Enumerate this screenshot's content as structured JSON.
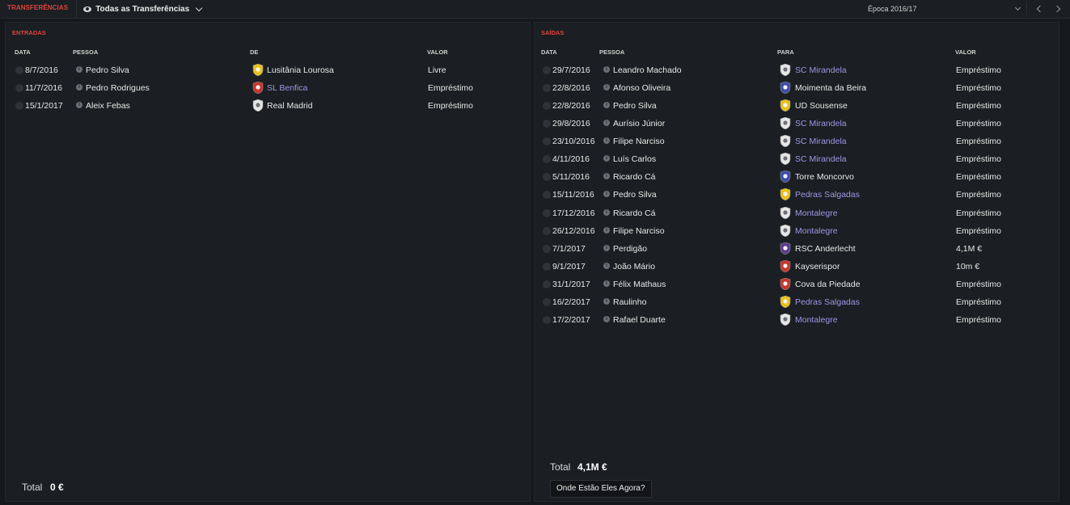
{
  "header": {
    "title": "TRANSFERÊNCIAS",
    "view_label": "Todas as Transferências",
    "season": "Época 2016/17"
  },
  "incoming": {
    "title": "ENTRADAS",
    "columns": {
      "date": "DATA",
      "person": "PESSOA",
      "club": "DE",
      "value": "VALOR"
    },
    "rows": [
      {
        "date": "8/7/2016",
        "person": "Pedro Silva",
        "club": "Lusitânia Lourosa",
        "club_link": false,
        "crest": "crest-yellow",
        "value": "Livre"
      },
      {
        "date": "11/7/2016",
        "person": "Pedro Rodrigues",
        "club": "SL Benfica",
        "club_link": true,
        "crest": "crest-red",
        "value": "Empréstimo"
      },
      {
        "date": "15/1/2017",
        "person": "Aleix Febas",
        "club": "Real Madrid",
        "club_link": false,
        "crest": "crest-white",
        "value": "Empréstimo"
      }
    ],
    "total_label": "Total",
    "total_value": "0 €"
  },
  "outgoing": {
    "title": "SAÍDAS",
    "columns": {
      "date": "DATA",
      "person": "PESSOA",
      "club": "PARA",
      "value": "VALOR"
    },
    "rows": [
      {
        "date": "29/7/2016",
        "person": "Leandro Machado",
        "club": "SC Mirandela",
        "club_link": true,
        "crest": "crest-white",
        "value": "Empréstimo"
      },
      {
        "date": "22/8/2016",
        "person": "Afonso Oliveira",
        "club": "Moimenta da Beira",
        "club_link": false,
        "crest": "crest-blue",
        "value": "Empréstimo"
      },
      {
        "date": "22/8/2016",
        "person": "Pedro Silva",
        "club": "UD Sousense",
        "club_link": false,
        "crest": "crest-yellow",
        "value": "Empréstimo"
      },
      {
        "date": "29/8/2016",
        "person": "Aurísio Júnior",
        "club": "SC Mirandela",
        "club_link": true,
        "crest": "crest-white",
        "value": "Empréstimo"
      },
      {
        "date": "23/10/2016",
        "person": "Filipe Narciso",
        "club": "SC Mirandela",
        "club_link": true,
        "crest": "crest-white",
        "value": "Empréstimo"
      },
      {
        "date": "4/11/2016",
        "person": "Luís Carlos",
        "club": "SC Mirandela",
        "club_link": true,
        "crest": "crest-white",
        "value": "Empréstimo"
      },
      {
        "date": "5/11/2016",
        "person": "Ricardo Cá",
        "club": "Torre Moncorvo",
        "club_link": false,
        "crest": "crest-blue",
        "value": "Empréstimo"
      },
      {
        "date": "15/11/2016",
        "person": "Pedro Silva",
        "club": "Pedras Salgadas",
        "club_link": true,
        "crest": "crest-yellow",
        "value": "Empréstimo"
      },
      {
        "date": "17/12/2016",
        "person": "Ricardo Cá",
        "club": "Montalegre",
        "club_link": true,
        "crest": "crest-white",
        "value": "Empréstimo"
      },
      {
        "date": "26/12/2016",
        "person": "Filipe Narciso",
        "club": "Montalegre",
        "club_link": true,
        "crest": "crest-white",
        "value": "Empréstimo"
      },
      {
        "date": "7/1/2017",
        "person": "Perdigão",
        "club": "RSC Anderlecht",
        "club_link": false,
        "crest": "crest-purple",
        "value": "4,1M €"
      },
      {
        "date": "9/1/2017",
        "person": "João Mário",
        "club": "Kayserispor",
        "club_link": false,
        "crest": "crest-red",
        "value": "10m €"
      },
      {
        "date": "31/1/2017",
        "person": "Félix Mathaus",
        "club": "Cova da Piedade",
        "club_link": false,
        "crest": "crest-red",
        "value": "Empréstimo"
      },
      {
        "date": "16/2/2017",
        "person": "Raulinho",
        "club": "Pedras Salgadas",
        "club_link": true,
        "crest": "crest-yellow",
        "value": "Empréstimo"
      },
      {
        "date": "17/2/2017",
        "person": "Rafael Duarte",
        "club": "Montalegre",
        "club_link": true,
        "crest": "crest-white",
        "value": "Empréstimo"
      }
    ],
    "total_label": "Total",
    "total_value": "4,1M €",
    "where_button": "Onde Estão Eles Agora?"
  },
  "colors": {
    "accent": "#e0443e",
    "link": "#9d98e6",
    "crest-yellow": "#e8c21c",
    "crest-red": "#c8362f",
    "crest-white": "#e6e6e6",
    "crest-blue": "#3d4fa8",
    "crest-purple": "#5b3d8f"
  }
}
